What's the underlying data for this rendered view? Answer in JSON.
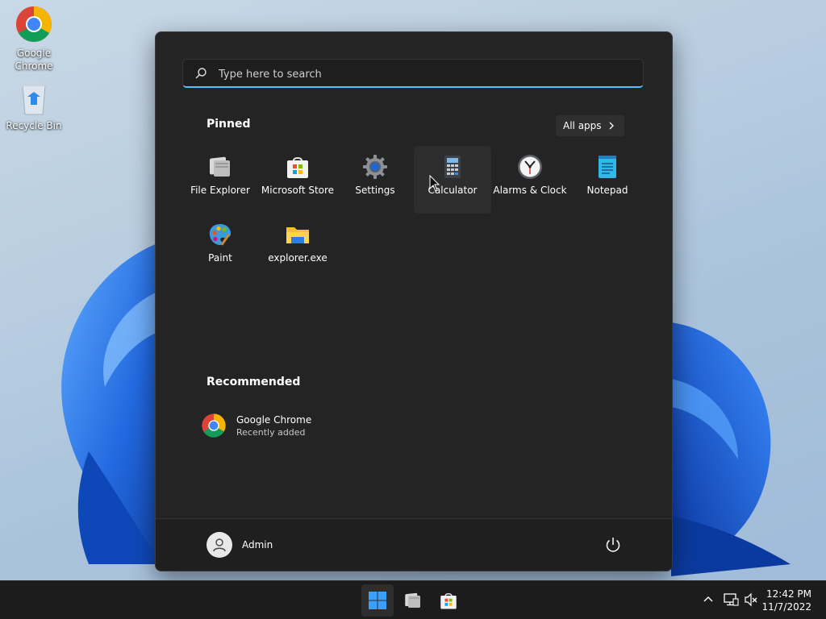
{
  "desktop": {
    "icons": [
      {
        "label_1": "Google",
        "label_2": "Chrome"
      },
      {
        "label": "Recycle Bin"
      }
    ]
  },
  "start_menu": {
    "search": {
      "placeholder": "Type here to search"
    },
    "pinned": {
      "title": "Pinned",
      "all_apps_label": "All apps",
      "apps": [
        {
          "label": "File Explorer",
          "icon": "file-explorer-icon"
        },
        {
          "label": "Microsoft Store",
          "icon": "microsoft-store-icon"
        },
        {
          "label": "Settings",
          "icon": "settings-gear-icon"
        },
        {
          "label": "Calculator",
          "icon": "calculator-icon"
        },
        {
          "label": "Alarms & Clock",
          "icon": "alarms-clock-icon"
        },
        {
          "label": "Notepad",
          "icon": "notepad-icon"
        },
        {
          "label": "Paint",
          "icon": "paint-palette-icon"
        },
        {
          "label": "explorer.exe",
          "icon": "folder-icon"
        }
      ]
    },
    "recommended": {
      "title": "Recommended",
      "items": [
        {
          "name": "Google Chrome",
          "detail": "Recently added",
          "icon": "chrome-icon"
        }
      ]
    },
    "footer": {
      "user_name": "Admin"
    }
  },
  "taskbar": {
    "apps": [
      {
        "icon": "windows-start-icon",
        "active": true
      },
      {
        "icon": "file-explorer-icon",
        "active": false
      },
      {
        "icon": "microsoft-store-icon",
        "active": false
      }
    ],
    "tray": {
      "time": "12:42 PM",
      "date": "11/7/2022",
      "icons": [
        "chevron-up-icon",
        "network-icon",
        "volume-muted-icon"
      ]
    }
  },
  "colors": {
    "start_bg": "#242424",
    "accent": "#4cc2ff",
    "taskbar_bg": "#1c1c1c",
    "bloom_blue": "#1b64e0"
  }
}
